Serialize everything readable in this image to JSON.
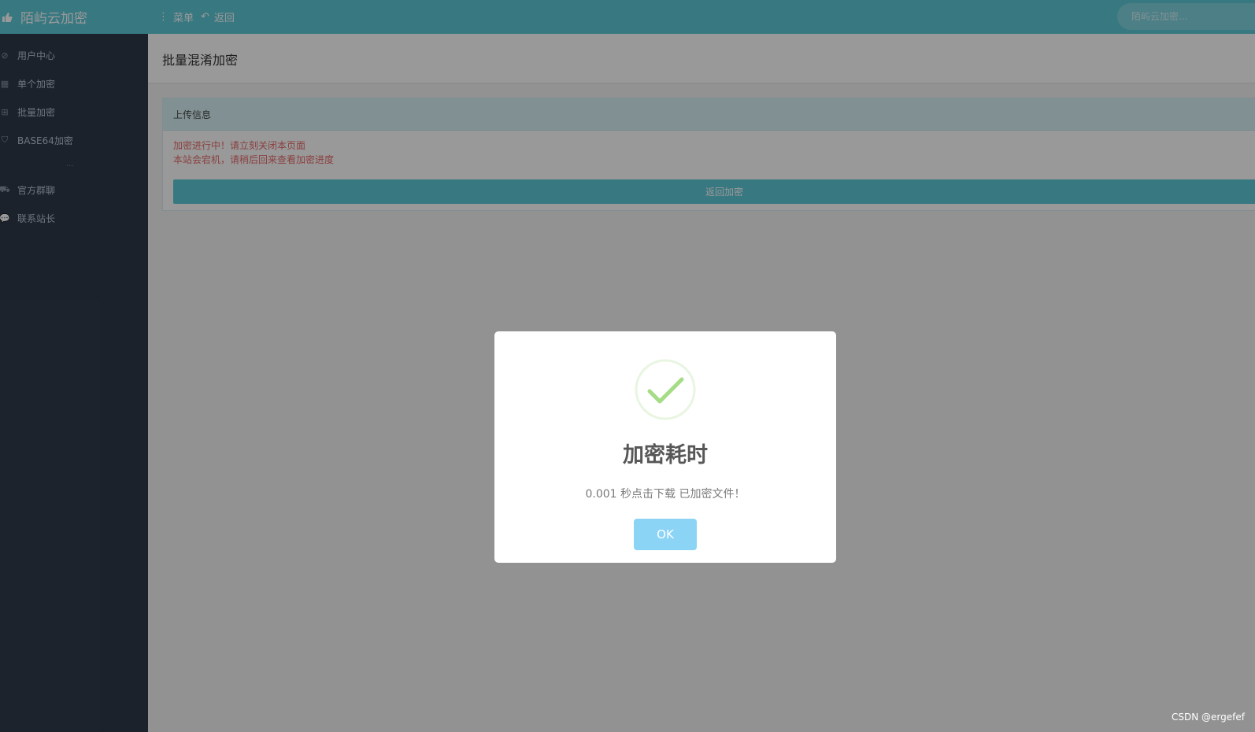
{
  "topbar": {
    "brand_title": "陌屿云加密",
    "menu_label": "菜单",
    "back_label": "返回",
    "search_placeholder": "陌屿云加密...",
    "accent_color": "#5ec9d8"
  },
  "sidebar": {
    "items": [
      {
        "label": "用户中心",
        "icon": "check-circle-icon"
      },
      {
        "label": "单个加密",
        "icon": "grid-icon"
      },
      {
        "label": "批量加密",
        "icon": "plus-square-icon"
      },
      {
        "label": "BASE64加密",
        "icon": "shield-icon"
      },
      {
        "label": "官方群聊",
        "icon": "cart-icon"
      },
      {
        "label": "联系站长",
        "icon": "chat-icon"
      }
    ],
    "separator": "..."
  },
  "main": {
    "page_title": "批量混淆加密",
    "panel": {
      "title": "上传信息",
      "messages": [
        "加密进行中！请立刻关闭本页面",
        "本站会宕机，请稍后回来查看加密进度"
      ],
      "back_button_label": "返回加密"
    }
  },
  "dialog": {
    "icon": "success-check-icon",
    "title": "加密耗时",
    "text": "0.001 秒点击下载 已加密文件！",
    "ok_label": "OK",
    "ok_color": "#8cd4f5",
    "check_color": "#a5dc86"
  },
  "watermark": "CSDN @ergefef"
}
